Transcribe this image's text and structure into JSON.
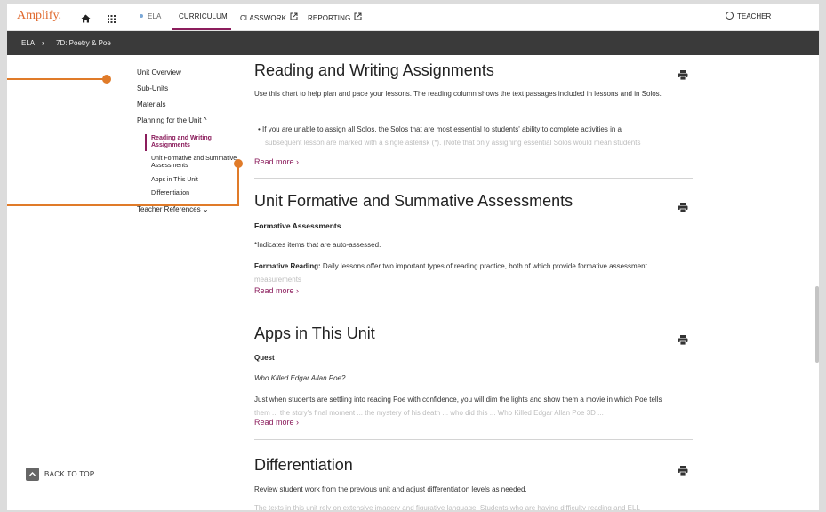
{
  "nav": {
    "logo": "Amplify.",
    "ela": "ELA",
    "curriculum": "CURRICULUM",
    "classwork": "CLASSWORK",
    "reporting": "REPORTING",
    "user": "TEACHER"
  },
  "breadcrumb": {
    "root": "ELA",
    "separator": "›",
    "current": "7D: Poetry & Poe"
  },
  "sidebar": {
    "unit_overview": "Unit Overview",
    "sub_units": "Sub-Units",
    "materials": "Materials",
    "planning": "Planning for the Unit ^",
    "sub_items": [
      "Reading and Writing Assignments",
      "Unit Formative and Summative Assessments",
      "Apps in This Unit",
      "Differentiation"
    ],
    "teacher_refs": "Teacher References ⌄"
  },
  "sections": {
    "rw": {
      "title": "Reading and Writing Assignments",
      "p1": "Use this chart to help plan and pace your lessons. The reading column shows the text passages included in lessons and in Solos.",
      "bullet": "• If you are unable to assign all Solos, the Solos that are most essential to students' ability to complete activities in a",
      "bullet_fade": "subsequent lesson are marked with a single asterisk (*). (Note that only assigning essential Solos would mean students",
      "readmore": "Read more  ›"
    },
    "assess": {
      "title": "Unit Formative and Summative Assessments",
      "subhead": "Formative Assessments",
      "p1": "*Indicates items that are auto-assessed.",
      "p2_bold": "Formative Reading:",
      "p2": " Daily lessons offer two important types of reading practice, both of which provide formative assessment",
      "p2_fade": "measurements",
      "readmore": "Read more  ›"
    },
    "apps": {
      "title": "Apps in This Unit",
      "subhead": "Quest",
      "italic": "Who Killed Edgar Allan Poe?",
      "p1": "Just when students are settling into reading Poe with confidence, you will dim the lights and show them a movie in which Poe tells",
      "p1_fade": "them ... the story's final moment ... the mystery of his death ... who did this ... Who Killed Edgar Allan Poe 3D ...",
      "readmore": "Read more  ›"
    },
    "diff": {
      "title": "Differentiation",
      "p1": "Review student work from the previous unit and adjust differentiation levels as needed.",
      "p2_fade": "The texts in this unit rely on extensive imagery and figurative language. Students who are having difficulty reading and ELL"
    }
  },
  "back_to_top": "BACK TO TOP",
  "colors": {
    "brand": "#e06a2f",
    "accent": "#8b1d5c",
    "callout": "#e07b29",
    "header_bar": "#3a3a3a"
  }
}
